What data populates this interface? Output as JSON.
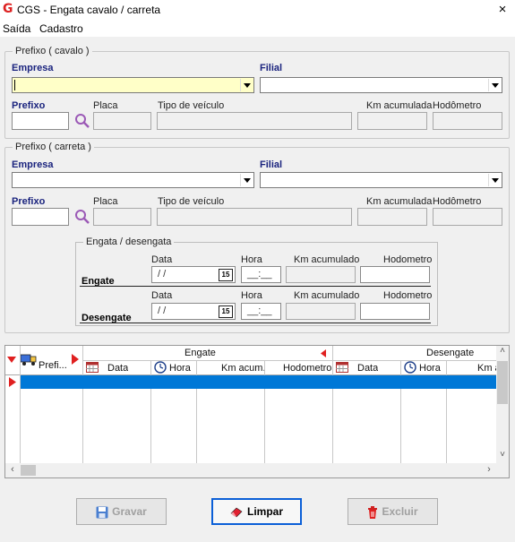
{
  "window": {
    "title": "CGS - Engata cavalo / carreta",
    "close_glyph": "×"
  },
  "menu": [
    "Saída",
    "Cadastro"
  ],
  "cavalo": {
    "legend": "Prefixo ( cavalo )",
    "empresa_label": "Empresa",
    "filial_label": "Filial",
    "prefixo_label": "Prefixo",
    "placa_label": "Placa",
    "tipo_label": "Tipo de veículo",
    "km_label": "Km acumulada",
    "hodometro_label": "Hodômetro"
  },
  "carreta": {
    "legend": "Prefixo ( carreta )",
    "empresa_label": "Empresa",
    "filial_label": "Filial",
    "prefixo_label": "Prefixo",
    "placa_label": "Placa",
    "tipo_label": "Tipo de veículo",
    "km_label": "Km acumulada",
    "hodometro_label": "Hodômetro"
  },
  "engata": {
    "legend": "Engata / desengata",
    "data_label": "Data",
    "hora_label": "Hora",
    "km_label": "Km acumulado",
    "hodometro_label": "Hodometro",
    "engate_label": "Engate",
    "desengate_label": "Desengate",
    "date_placeholder": "/ /",
    "time_placeholder": "__:__",
    "cal_text": "15"
  },
  "grid": {
    "prefix_header": "Prefi...",
    "engate_header": "Engate",
    "desengate_header": "Desengate",
    "columns": [
      "Data",
      "Hora",
      "Km acum.",
      "Hodometro",
      "Data",
      "Hora",
      "Km ac"
    ]
  },
  "buttons": {
    "gravar": "Gravar",
    "limpar": "Limpar",
    "excluir": "Excluir"
  },
  "colors": {
    "accent": "#0b5fd7",
    "selected_row": "#0078d7",
    "yellow_field": "#ffffc8"
  }
}
